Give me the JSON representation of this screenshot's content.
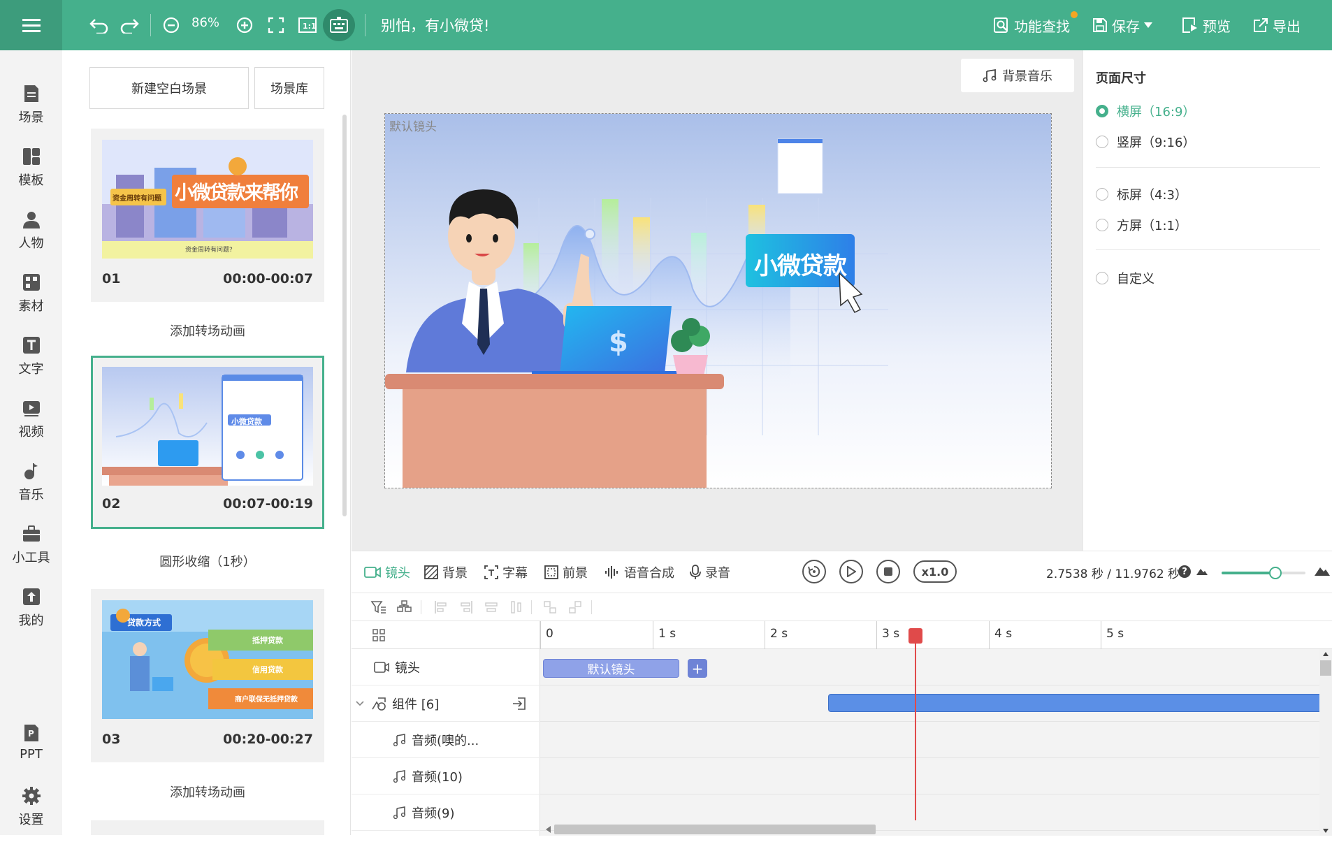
{
  "toolbar": {
    "zoom_value": "86%",
    "slogan": "别怕，有小微贷!",
    "find_label": "功能查找",
    "save_label": "保存",
    "preview_label": "预览",
    "export_label": "导出"
  },
  "leftnav": {
    "items": [
      {
        "label": "场景",
        "icon": "document-icon"
      },
      {
        "label": "模板",
        "icon": "template-icon"
      },
      {
        "label": "人物",
        "icon": "person-icon"
      },
      {
        "label": "素材",
        "icon": "material-icon"
      },
      {
        "label": "文字",
        "icon": "text-icon"
      },
      {
        "label": "视频",
        "icon": "video-icon"
      },
      {
        "label": "音乐",
        "icon": "music-icon"
      },
      {
        "label": "小工具",
        "icon": "toolbox-icon"
      },
      {
        "label": "我的",
        "icon": "upload-icon"
      },
      {
        "label": "PPT",
        "icon": "ppt-icon"
      },
      {
        "label": "设置",
        "icon": "gear-icon"
      }
    ]
  },
  "scenes": {
    "new_blank_label": "新建空白场景",
    "library_label": "场景库",
    "items": [
      {
        "num": "01",
        "time": "00:00-00:07",
        "thumb_title": "小微贷款来帮你",
        "thumb_tag": "资金周转有问题",
        "thumb_sub": "资金周转有问题?"
      },
      {
        "num": "02",
        "time": "00:07-00:19",
        "thumb_title": "小微贷款"
      },
      {
        "num": "03",
        "time": "00:20-00:27",
        "thumb_title": "贷款方式",
        "opt1": "抵押贷款",
        "opt2": "信用贷款",
        "opt3": "商户联保无抵押贷款"
      }
    ],
    "transitions": [
      "添加转场动画",
      "圆形收缩（1秒）",
      "添加转场动画"
    ]
  },
  "canvas": {
    "bgm_label": "背景音乐",
    "stage_label": "默认镜头",
    "stage_banner": "小微贷款"
  },
  "props": {
    "title": "页面尺寸",
    "options": [
      "横屏（16:9）",
      "竖屏（9:16）",
      "标屏（4:3）",
      "方屏（1:1）",
      "自定义"
    ],
    "selected_index": 0
  },
  "timeline": {
    "tabs": [
      "镜头",
      "背景",
      "字幕",
      "前景",
      "语音合成",
      "录音"
    ],
    "speed_label": "x1.0",
    "time_readout": "2.7538 秒 / 11.9762 秒",
    "zoom_fraction": 0.64,
    "ruler_ticks": [
      "0",
      "1 s",
      "2 s",
      "3 s",
      "4 s",
      "5 s"
    ],
    "rows": [
      {
        "label": "镜头",
        "icon": "camera-icon"
      },
      {
        "label": "组件 [6]",
        "icon": "component-icon"
      },
      {
        "label": "音频(噢的...",
        "icon": "music-note-icon"
      },
      {
        "label": "音频(10)",
        "icon": "music-note-icon"
      },
      {
        "label": "音频(9)",
        "icon": "music-note-icon"
      }
    ],
    "camera_clip_label": "默认镜头",
    "add_clip_label": "+",
    "playhead_seconds": 2.7538
  },
  "colors": {
    "primary": "#45b08c",
    "clip_camera": "#8fa2e8",
    "clip_component": "#5b8fe6",
    "playhead": "#e04a4a"
  }
}
